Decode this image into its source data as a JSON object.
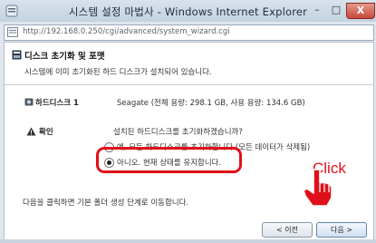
{
  "window": {
    "title": "시스템 설정 마법사 - Windows Internet Explorer",
    "controls": {
      "minimize": "–",
      "maximize": "□",
      "close": "X"
    }
  },
  "address_bar": {
    "url": "http://192.168.0.250/cgi/advanced/system_wizard.cgi"
  },
  "wizard": {
    "title": "디스크 초기화 및 포맷",
    "subtitle": "시스템에 이미 초기화된 하드 디스크가 설치되어 있습니다.",
    "disk": {
      "name": "하드디스크 1",
      "info": "Seagate (전체 용량: 298.1 GB, 사용 용량: 134.6 GB)"
    },
    "confirm": {
      "label": "확인",
      "question": "설치된 하드디스크를 초기화하겠습니까?",
      "options": [
        {
          "label": "예, 모든 하드디스크를 초기화합니다.(모든 데이터가 삭제됨)",
          "selected": false
        },
        {
          "label": "아니오. 현재 상태를 유지합니다.",
          "selected": true
        }
      ]
    },
    "footer_text": "다음을 클릭하면 기본 폴더 생성 단계로 이동합니다.",
    "buttons": {
      "prev": "< 이전",
      "next": "다음 >"
    }
  },
  "annotation": {
    "click_label": "Click",
    "highlight_color": "#e0101a"
  }
}
